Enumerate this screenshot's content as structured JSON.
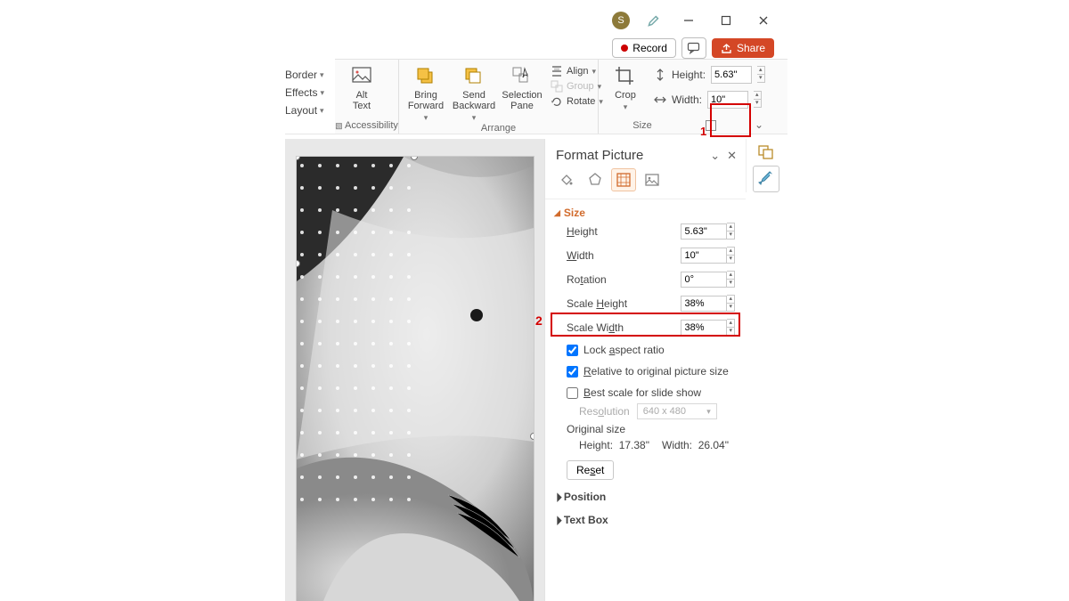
{
  "titlebar": {
    "avatar_letter": "S"
  },
  "secondrow": {
    "record": "Record",
    "share": "Share"
  },
  "leftlabels": {
    "border": "Border",
    "effects": "Effects",
    "layout": "Layout"
  },
  "ribbon": {
    "accessibility": {
      "label": "Accessibility",
      "alt_text": "Alt\nText"
    },
    "arrange": {
      "label": "Arrange",
      "bring_forward": "Bring\nForward",
      "send_backward": "Send\nBackward",
      "selection_pane": "Selection\nPane",
      "align": "Align",
      "group": "Group",
      "rotate": "Rotate"
    },
    "size": {
      "label": "Size",
      "crop": "Crop",
      "height_label": "Height:",
      "height_value": "5.63\"",
      "width_label": "Width:",
      "width_value": "10\""
    }
  },
  "annotations": {
    "n1": "1",
    "n2": "2"
  },
  "pane": {
    "title": "Format Picture",
    "size_section": "Size",
    "height_label": "Height",
    "height_value": "5.63\"",
    "width_label": "Width",
    "width_value": "10\"",
    "rotation_label": "Rotation",
    "rotation_value": "0°",
    "scale_height_label": "Scale Height",
    "scale_height_value": "38%",
    "scale_width_label": "Scale Width",
    "scale_width_value": "38%",
    "lock_aspect": "Lock aspect ratio",
    "relative_original": "Relative to original picture size",
    "best_scale": "Best scale for slide show",
    "resolution_label": "Resolution",
    "resolution_value": "640 x 480",
    "original_size": "Original size",
    "orig_height_label": "Height:",
    "orig_height_value": "17.38\"",
    "orig_width_label": "Width:",
    "orig_width_value": "26.04\"",
    "reset": "Reset",
    "position_section": "Position",
    "textbox_section": "Text Box"
  }
}
